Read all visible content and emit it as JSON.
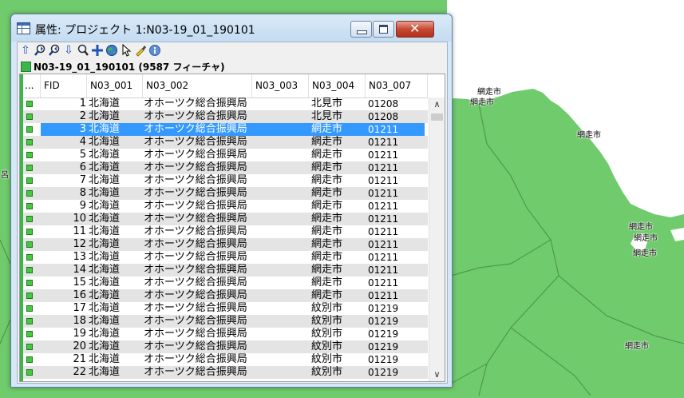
{
  "window": {
    "title": "属性: プロジェクト 1:N03-19_01_190101",
    "close_glyph": "✕"
  },
  "toolbar": {
    "icons": [
      "arrow-up-icon",
      "zoom-previous-icon",
      "zoom-next-icon",
      "arrow-down-icon",
      "zoom-icon",
      "pan-icon",
      "globe-icon",
      "pointer-icon",
      "highlight-icon",
      "info-icon"
    ]
  },
  "layer": {
    "title": "N03-19_01_190101 (9587 フィーチャ)",
    "swatch_color": "#3cb54a"
  },
  "table": {
    "columns": [
      "...",
      "FID",
      "N03_001",
      "N03_002",
      "N03_003",
      "N03_004",
      "N03_007"
    ],
    "selected_fid": "3",
    "rows": [
      {
        "fid": "1",
        "n03_001": "北海道",
        "n03_002": "オホーツク総合振興局",
        "n03_003": "",
        "n03_004": "北見市",
        "n03_007": "01208"
      },
      {
        "fid": "2",
        "n03_001": "北海道",
        "n03_002": "オホーツク総合振興局",
        "n03_003": "",
        "n03_004": "北見市",
        "n03_007": "01208"
      },
      {
        "fid": "3",
        "n03_001": "北海道",
        "n03_002": "オホーツク総合振興局",
        "n03_003": "",
        "n03_004": "網走市",
        "n03_007": "01211"
      },
      {
        "fid": "4",
        "n03_001": "北海道",
        "n03_002": "オホーツク総合振興局",
        "n03_003": "",
        "n03_004": "網走市",
        "n03_007": "01211"
      },
      {
        "fid": "5",
        "n03_001": "北海道",
        "n03_002": "オホーツク総合振興局",
        "n03_003": "",
        "n03_004": "網走市",
        "n03_007": "01211"
      },
      {
        "fid": "6",
        "n03_001": "北海道",
        "n03_002": "オホーツク総合振興局",
        "n03_003": "",
        "n03_004": "網走市",
        "n03_007": "01211"
      },
      {
        "fid": "7",
        "n03_001": "北海道",
        "n03_002": "オホーツク総合振興局",
        "n03_003": "",
        "n03_004": "網走市",
        "n03_007": "01211"
      },
      {
        "fid": "8",
        "n03_001": "北海道",
        "n03_002": "オホーツク総合振興局",
        "n03_003": "",
        "n03_004": "網走市",
        "n03_007": "01211"
      },
      {
        "fid": "9",
        "n03_001": "北海道",
        "n03_002": "オホーツク総合振興局",
        "n03_003": "",
        "n03_004": "網走市",
        "n03_007": "01211"
      },
      {
        "fid": "10",
        "n03_001": "北海道",
        "n03_002": "オホーツク総合振興局",
        "n03_003": "",
        "n03_004": "網走市",
        "n03_007": "01211"
      },
      {
        "fid": "11",
        "n03_001": "北海道",
        "n03_002": "オホーツク総合振興局",
        "n03_003": "",
        "n03_004": "網走市",
        "n03_007": "01211"
      },
      {
        "fid": "12",
        "n03_001": "北海道",
        "n03_002": "オホーツク総合振興局",
        "n03_003": "",
        "n03_004": "網走市",
        "n03_007": "01211"
      },
      {
        "fid": "13",
        "n03_001": "北海道",
        "n03_002": "オホーツク総合振興局",
        "n03_003": "",
        "n03_004": "網走市",
        "n03_007": "01211"
      },
      {
        "fid": "14",
        "n03_001": "北海道",
        "n03_002": "オホーツク総合振興局",
        "n03_003": "",
        "n03_004": "網走市",
        "n03_007": "01211"
      },
      {
        "fid": "15",
        "n03_001": "北海道",
        "n03_002": "オホーツク総合振興局",
        "n03_003": "",
        "n03_004": "網走市",
        "n03_007": "01211"
      },
      {
        "fid": "16",
        "n03_001": "北海道",
        "n03_002": "オホーツク総合振興局",
        "n03_003": "",
        "n03_004": "網走市",
        "n03_007": "01211"
      },
      {
        "fid": "17",
        "n03_001": "北海道",
        "n03_002": "オホーツク総合振興局",
        "n03_003": "",
        "n03_004": "紋別市",
        "n03_007": "01219"
      },
      {
        "fid": "18",
        "n03_001": "北海道",
        "n03_002": "オホーツク総合振興局",
        "n03_003": "",
        "n03_004": "紋別市",
        "n03_007": "01219"
      },
      {
        "fid": "19",
        "n03_001": "北海道",
        "n03_002": "オホーツク総合振興局",
        "n03_003": "",
        "n03_004": "紋別市",
        "n03_007": "01219"
      },
      {
        "fid": "20",
        "n03_001": "北海道",
        "n03_002": "オホーツク総合振興局",
        "n03_003": "",
        "n03_004": "紋別市",
        "n03_007": "01219"
      },
      {
        "fid": "21",
        "n03_001": "北海道",
        "n03_002": "オホーツク総合振興局",
        "n03_003": "",
        "n03_004": "紋別市",
        "n03_007": "01219"
      },
      {
        "fid": "22",
        "n03_001": "北海道",
        "n03_002": "オホーツク総合振興局",
        "n03_003": "",
        "n03_004": "紋別市",
        "n03_007": "01219"
      }
    ]
  },
  "map": {
    "sea_color": "#ffffff",
    "land_color": "#6fcb6b",
    "labels": [
      "網走市",
      "網走市",
      "網走市",
      "網走市",
      "網走市",
      "網走市",
      "網走市",
      "呂"
    ]
  }
}
